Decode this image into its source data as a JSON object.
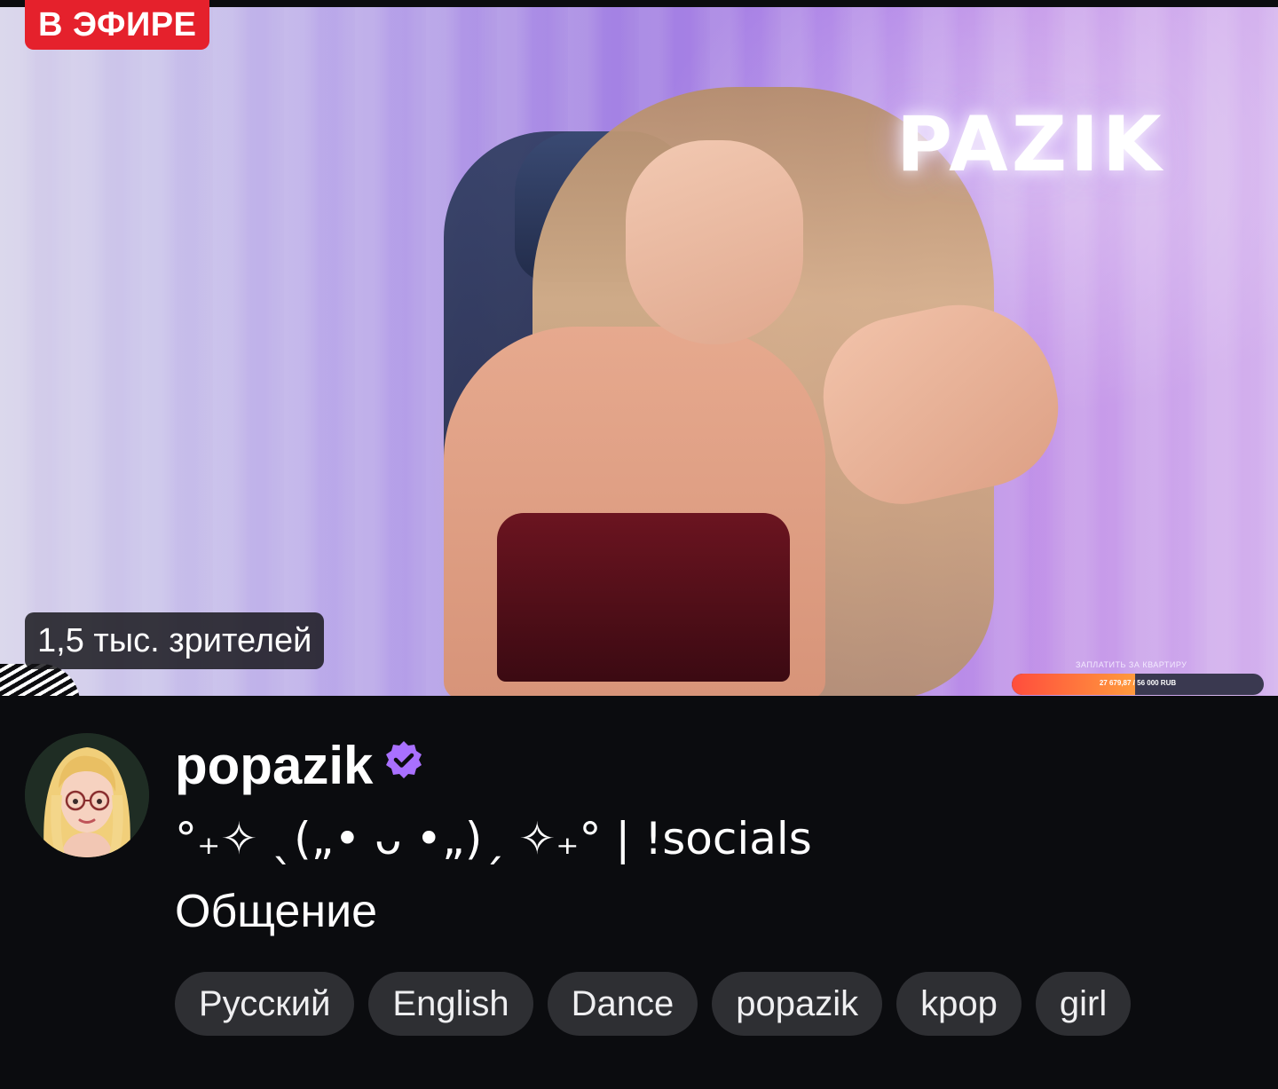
{
  "player": {
    "live_badge": "В ЭФИРЕ",
    "viewers": "1,5 тыс. зрителей",
    "overlay_logo": "PAZIK",
    "donation_goal": {
      "title": "ЗАПЛАТИТЬ ЗА КВАРТИРУ",
      "amount": "27 679,87 / 56 000 RUB",
      "progress_fraction": 0.49
    }
  },
  "channel": {
    "name": "popazik",
    "verified_icon": "verified-badge-icon",
    "stream_title": "°˖✧ ◝(⁰▿⁰)◜ ✧˖° | !socials",
    "stream_title_display": "°₊✧ ˎ(„• ᴗ •„)ˏ ✧₊° | !socials",
    "category": "Общение",
    "tags": [
      "Русский",
      "English",
      "Dance",
      "popazik",
      "kpop",
      "girl"
    ]
  },
  "colors": {
    "live_red": "#e5212c",
    "verified_purple": "#a970ff",
    "background": "#0b0c0f",
    "tag_bg": "#2e2f33"
  }
}
